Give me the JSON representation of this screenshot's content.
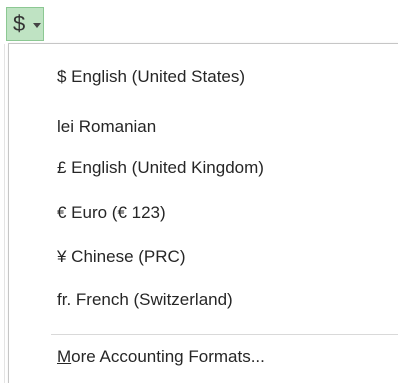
{
  "button": {
    "symbol": "$",
    "icon": "chevron-down-icon"
  },
  "menu": {
    "items": [
      {
        "label": "$ English (United States)"
      },
      {
        "label": "lei Romanian"
      },
      {
        "label": "£ English (United Kingdom)"
      },
      {
        "label": "€ Euro (€ 123)"
      },
      {
        "label": "¥ Chinese (PRC)"
      },
      {
        "label": "fr. French (Switzerland)"
      }
    ],
    "more": {
      "accelerator": "M",
      "rest": "ore Accounting Formats..."
    }
  },
  "colors": {
    "button_bg": "#bfe3c3",
    "button_border": "#8cc893",
    "text": "#262626",
    "separator": "#d9d9d9"
  }
}
